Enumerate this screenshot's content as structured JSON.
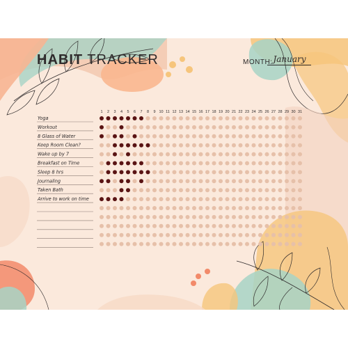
{
  "header": {
    "title_bold": "HABIT",
    "title_rest": " TRACKER",
    "month_label": "MONTH:",
    "month_value": "January"
  },
  "days": [
    "1",
    "2",
    "3",
    "4",
    "5",
    "6",
    "7",
    "8",
    "9",
    "10",
    "11",
    "12",
    "13",
    "14",
    "15",
    "16",
    "17",
    "18",
    "19",
    "20",
    "21",
    "22",
    "23",
    "24",
    "25",
    "26",
    "27",
    "28",
    "29",
    "30",
    "31"
  ],
  "habits": [
    {
      "label": "Yoga",
      "done": [
        1,
        2,
        3,
        4,
        5,
        6,
        7
      ]
    },
    {
      "label": "Workout",
      "done": [
        1,
        4
      ]
    },
    {
      "label": "8 Glass of Water",
      "done": [
        1,
        3,
        4,
        6
      ]
    },
    {
      "label": "Keep Room Clean?",
      "done": [
        3,
        4,
        5,
        6,
        7,
        8
      ]
    },
    {
      "label": "Wake up by 7",
      "done": [
        3,
        5
      ]
    },
    {
      "label": "Breakfast on Time",
      "done": [
        2,
        3,
        4,
        5,
        6,
        7
      ]
    },
    {
      "label": "Sleep 8 hrs",
      "done": [
        2,
        3,
        4,
        5,
        6,
        7,
        8
      ]
    },
    {
      "label": "Journaling",
      "done": [
        1,
        2,
        4,
        5,
        7
      ]
    },
    {
      "label": "Taken Bath",
      "done": [
        4,
        5
      ]
    },
    {
      "label": "Arrive to work on time",
      "done": [
        1,
        2,
        3,
        4
      ]
    },
    {
      "label": "",
      "done": []
    },
    {
      "label": "",
      "done": []
    },
    {
      "label": "",
      "done": []
    },
    {
      "label": "",
      "done": []
    },
    {
      "label": "",
      "done": []
    }
  ],
  "colors": {
    "done_dot": "#5a1414",
    "empty_dot": "#e6c0a9",
    "text": "#2e2a2b",
    "line": "#8b7a73"
  }
}
